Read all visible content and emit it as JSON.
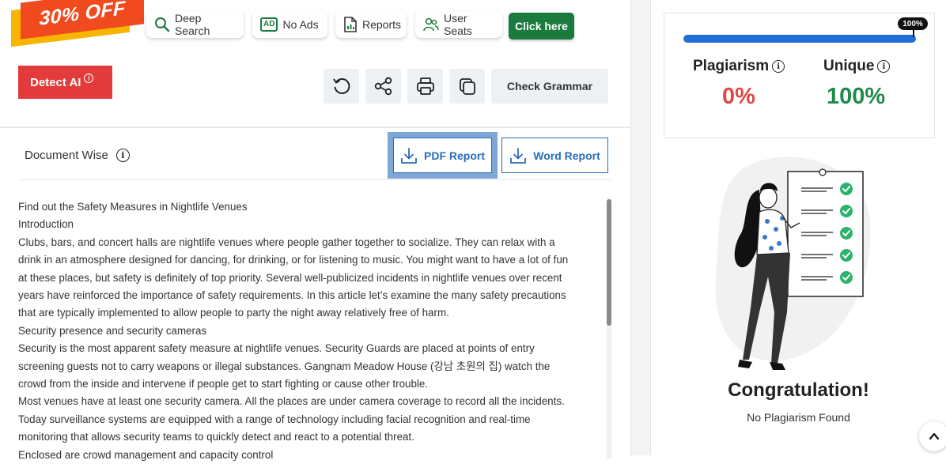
{
  "promo": {
    "label": "30% OFF"
  },
  "toolbar": {
    "deep_search": "Deep Search",
    "no_ads": "No Ads",
    "reports": "Reports",
    "user_seats": "User Seats",
    "click_here": "Click here",
    "ad_badge": "AD"
  },
  "actions": {
    "detect_ai": "Detect AI",
    "detect_ai_info": "i",
    "check_grammar": "Check Grammar",
    "icons": [
      "refresh-icon",
      "share-icon",
      "print-icon",
      "copy-icon"
    ]
  },
  "document": {
    "mode_label": "Document Wise",
    "info": "i",
    "pdf_report": "PDF Report",
    "word_report": "Word Report",
    "lines": [
      "Find out the Safety Measures in Nightlife Venues",
      "Introduction",
      "Clubs, bars, and concert halls are nightlife venues where people gather together to socialize. They can relax with a",
      "drink in an atmosphere designed for dancing, for drinking, or for listening to music. You might want to have a lot of fun",
      "at these places, but safety is definitely of top priority. Several well-publicized incidents in nightlife venues over recent",
      "years have reinforced the importance of safety requirements. In this article let’s examine the many safety precautions",
      "that are typically implemented to allow people to party the night away relatively free of harm.",
      "Security presence and security cameras",
      "Security is the most apparent safety measure at nightlife venues. Security Guards are placed at points of entry",
      "screening guests not to carry weapons or illegal substances. Gangnam Meadow House (강남 초원의 집) watch the",
      "crowd from the inside and intervene if people get to start fighting or cause other trouble.",
      "Most venues have at least one security camera. All the places are under camera coverage to record all the incidents.",
      "Today surveillance systems are equipped with a range of technology including facial recognition and real-time",
      "monitoring that allows security teams to quickly detect and react to a potential threat.",
      "Enclosed are crowd management and capacity control"
    ]
  },
  "result": {
    "progress_label": "100%",
    "progress_fraction": 1.0,
    "plagiarism_label": "Plagiarism",
    "plagiarism_value": "0%",
    "unique_label": "Unique",
    "unique_value": "100%",
    "info": "i",
    "congrats_title": "Congratulation!",
    "congrats_sub": "No Plagiarism Found",
    "colors": {
      "plagiarism": "#e04848",
      "unique": "#1e8a4c",
      "bar": "#1f6fd6",
      "check": "#2bb36b"
    }
  }
}
